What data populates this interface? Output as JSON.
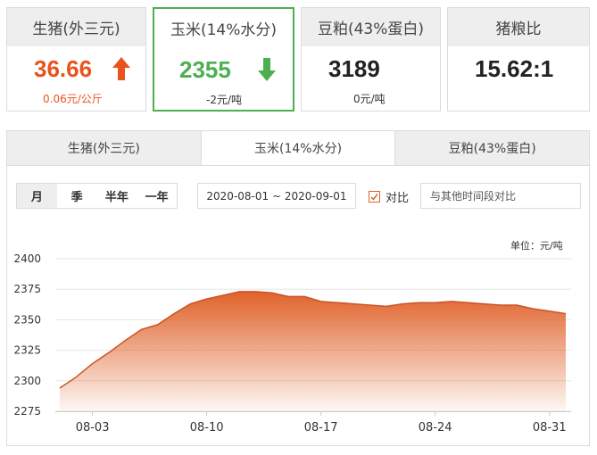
{
  "cards": [
    {
      "title": "生猪(外三元)",
      "value": "36.66",
      "change": "0.06元/公斤",
      "trend": "up"
    },
    {
      "title": "玉米(14%水分)",
      "value": "2355",
      "change": "-2元/吨",
      "trend": "down",
      "selected": true
    },
    {
      "title": "豆粕(43%蛋白)",
      "value": "3189",
      "change": "0元/吨",
      "trend": "flat"
    },
    {
      "title": "猪粮比",
      "value": "15.62:1"
    }
  ],
  "tabs": [
    "生猪(外三元)",
    "玉米(14%水分)",
    "豆粕(43%蛋白)"
  ],
  "active_tab": 1,
  "periods": [
    "月",
    "季",
    "半年",
    "一年"
  ],
  "active_period": 0,
  "date_range": "2020-08-01 ~ 2020-09-01",
  "compare_label": "对比",
  "compare_placeholder": "与其他时间段对比",
  "colors": {
    "up": "#e8541c",
    "down": "#4caf50",
    "selected_border": "#4caf50",
    "area_top": "#e0622a",
    "line": "#c95427"
  },
  "chart_data": {
    "type": "area",
    "unit_label": "单位：元/吨",
    "ylim": [
      2275,
      2400
    ],
    "yticks": [
      2275,
      2300,
      2325,
      2350,
      2375,
      2400
    ],
    "xticks": [
      {
        "label": "08-03",
        "day": 3
      },
      {
        "label": "08-10",
        "day": 10
      },
      {
        "label": "08-17",
        "day": 17
      },
      {
        "label": "08-24",
        "day": 24
      },
      {
        "label": "08-31",
        "day": 31
      }
    ],
    "x": [
      1,
      2,
      3,
      4,
      5,
      6,
      7,
      8,
      9,
      10,
      11,
      12,
      13,
      14,
      15,
      16,
      17,
      18,
      19,
      20,
      21,
      22,
      23,
      24,
      25,
      26,
      27,
      28,
      29,
      30,
      31,
      32
    ],
    "values": [
      2294,
      2303,
      2314,
      2323,
      2333,
      2342,
      2346,
      2355,
      2363,
      2367,
      2370,
      2373,
      2373,
      2372,
      2369,
      2369,
      2365,
      2364,
      2363,
      2362,
      2361,
      2363,
      2364,
      2364,
      2365,
      2364,
      2363,
      2362,
      2362,
      2359,
      2357,
      2355
    ],
    "grid": true
  }
}
